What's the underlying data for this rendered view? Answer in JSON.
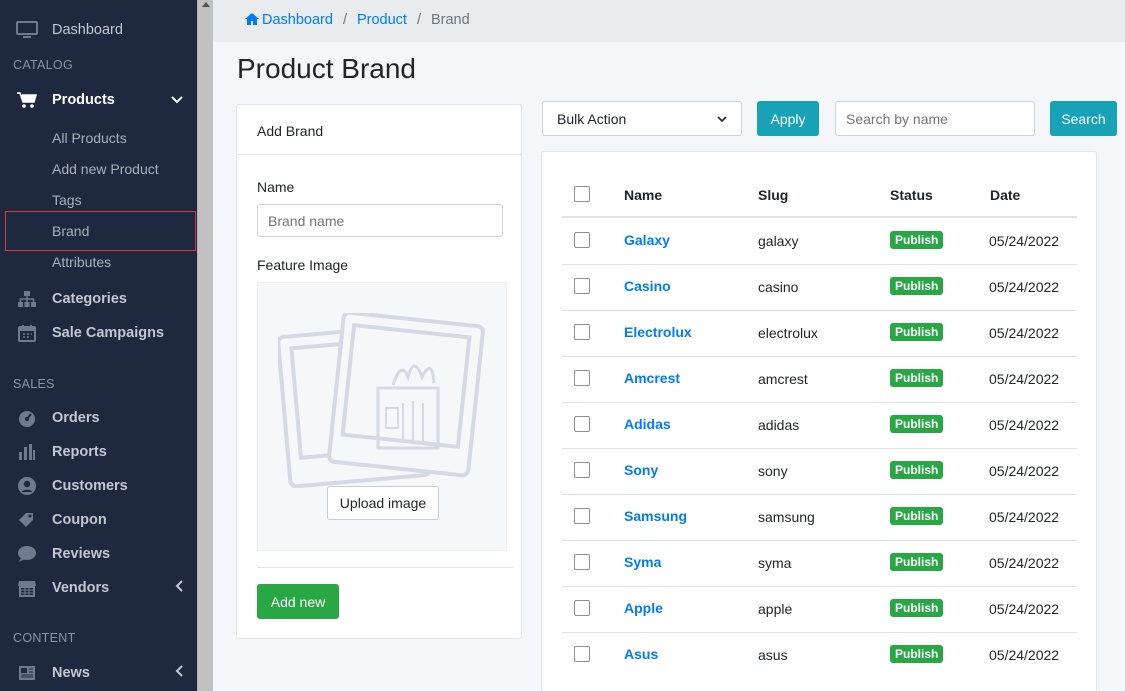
{
  "sidebar": {
    "dashboard": "Dashboard",
    "catalog_header": "CATALOG",
    "products": "Products",
    "products_sub": [
      "All Products",
      "Add new Product",
      "Tags",
      "Brand",
      "Attributes"
    ],
    "categories": "Categories",
    "sale_campaigns": "Sale Campaigns",
    "sales_header": "SALES",
    "orders": "Orders",
    "reports": "Reports",
    "customers": "Customers",
    "coupon": "Coupon",
    "reviews": "Reviews",
    "vendors": "Vendors",
    "content_header": "CONTENT",
    "news": "News",
    "active_item": "Brand"
  },
  "breadcrumb": {
    "items": [
      "Dashboard",
      "Product",
      "Brand"
    ]
  },
  "page_title": "Product Brand",
  "add_brand": {
    "title": "Add Brand",
    "name_label": "Name",
    "name_placeholder": "Brand name",
    "image_label": "Feature Image",
    "upload_label": "Upload image",
    "submit_label": "Add new"
  },
  "toolbar": {
    "bulk_action": "Bulk Action",
    "apply_label": "Apply",
    "search_placeholder": "Search by name",
    "search_label": "Search"
  },
  "table": {
    "headers": [
      "Name",
      "Slug",
      "Status",
      "Date"
    ],
    "rows": [
      {
        "name": "Galaxy",
        "slug": "galaxy",
        "status": "Publish",
        "date": "05/24/2022"
      },
      {
        "name": "Casino",
        "slug": "casino",
        "status": "Publish",
        "date": "05/24/2022"
      },
      {
        "name": "Electrolux",
        "slug": "electrolux",
        "status": "Publish",
        "date": "05/24/2022"
      },
      {
        "name": "Amcrest",
        "slug": "amcrest",
        "status": "Publish",
        "date": "05/24/2022"
      },
      {
        "name": "Adidas",
        "slug": "adidas",
        "status": "Publish",
        "date": "05/24/2022"
      },
      {
        "name": "Sony",
        "slug": "sony",
        "status": "Publish",
        "date": "05/24/2022"
      },
      {
        "name": "Samsung",
        "slug": "samsung",
        "status": "Publish",
        "date": "05/24/2022"
      },
      {
        "name": "Syma",
        "slug": "syma",
        "status": "Publish",
        "date": "05/24/2022"
      },
      {
        "name": "Apple",
        "slug": "apple",
        "status": "Publish",
        "date": "05/24/2022"
      },
      {
        "name": "Asus",
        "slug": "asus",
        "status": "Publish",
        "date": "05/24/2022"
      }
    ]
  },
  "colors": {
    "sidebar_bg": "#1e2940",
    "link": "#007bff",
    "info": "#17a2b8",
    "success": "#28a745",
    "active_outline": "#dc3545"
  }
}
